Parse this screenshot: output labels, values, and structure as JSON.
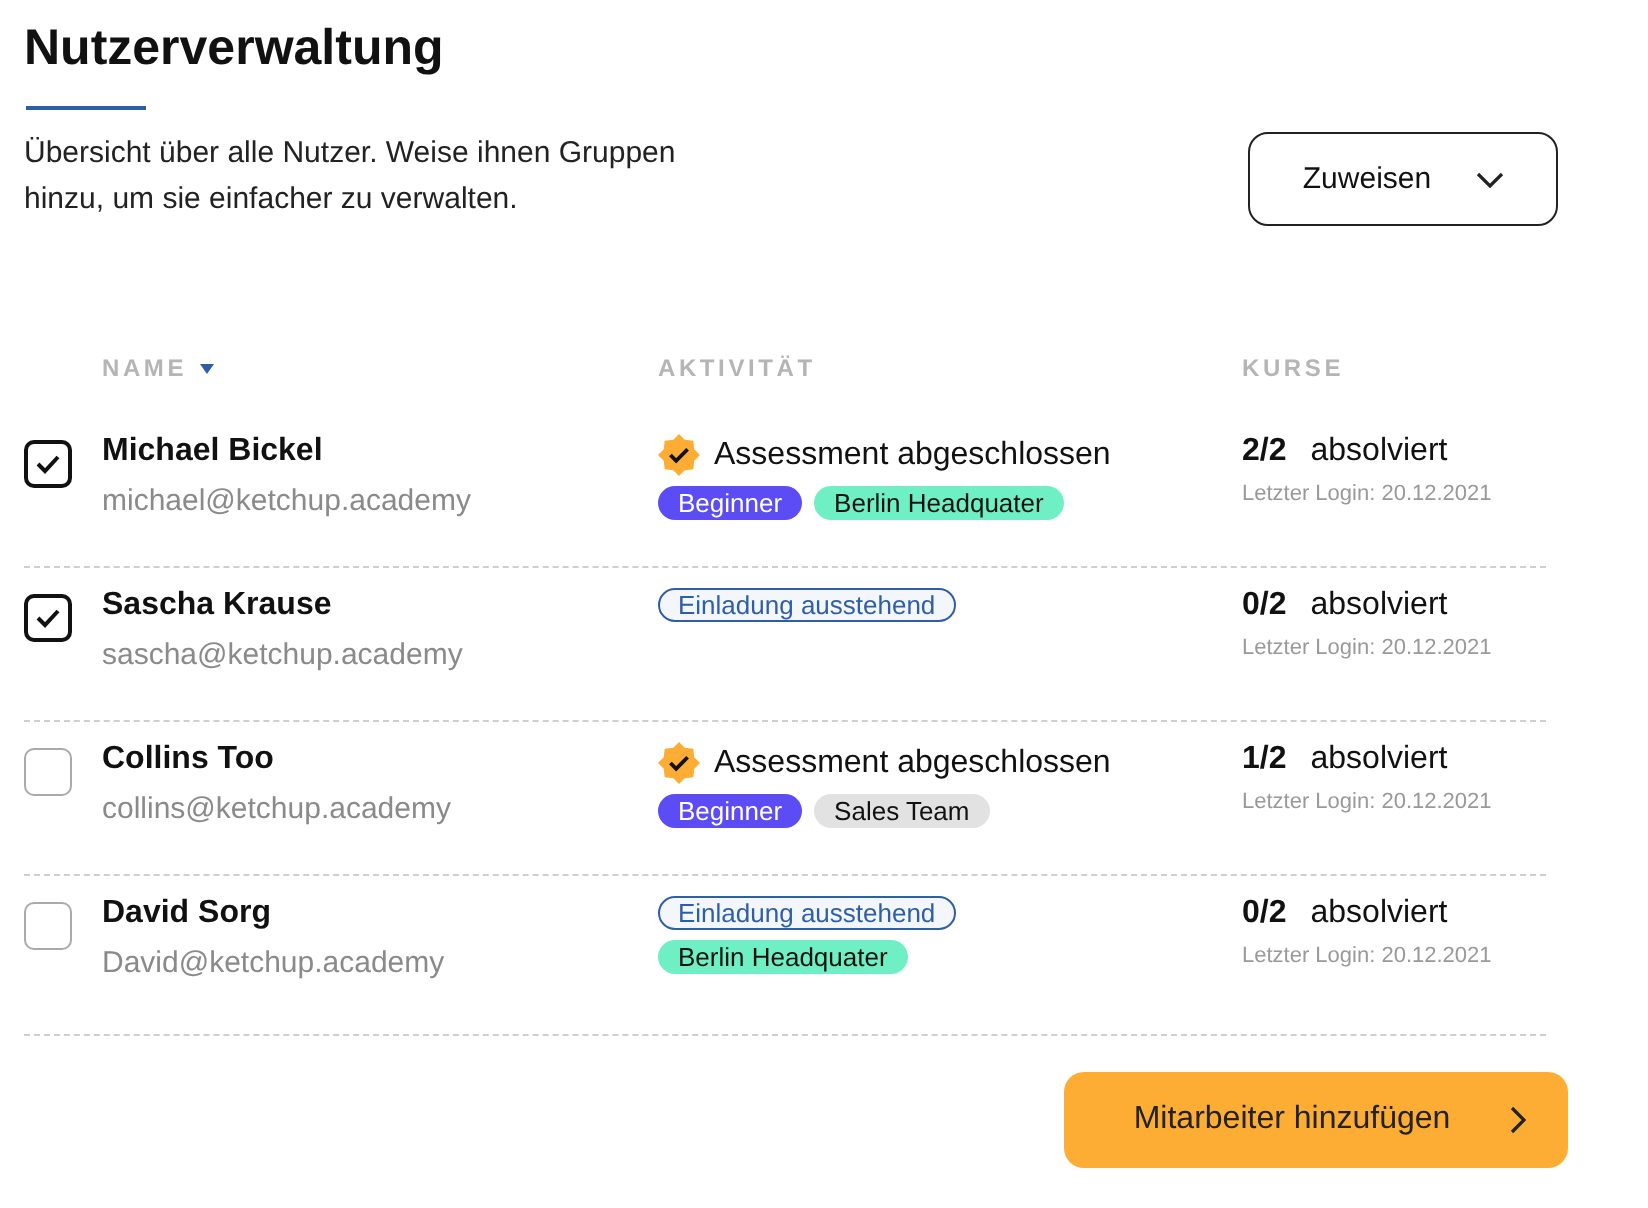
{
  "title": "Nutzerverwaltung",
  "description": "Übersicht über alle Nutzer. Weise ihnen Gruppen hinzu, um sie einfacher zu verwalten.",
  "assign_dropdown": {
    "label": "Zuweisen"
  },
  "table": {
    "columns": [
      {
        "label": "NAME",
        "sorted": true
      },
      {
        "label": "AKTIVITÄT",
        "sorted": false
      },
      {
        "label": "KURSE",
        "sorted": false
      }
    ],
    "rows": [
      {
        "checked": true,
        "name": "Michael Bickel",
        "email": "michael@ketchup.academy",
        "activity": {
          "kind": "assessment",
          "text": "Assessment abgeschlossen"
        },
        "tags": [
          {
            "label": "Beginner",
            "color": "#5b4cf5"
          },
          {
            "label": "Berlin Headquater",
            "color": "#6ef0c4"
          }
        ],
        "score": "2/2",
        "status": "absolviert",
        "last_login": "Letzter Login: 20.12.2021"
      },
      {
        "checked": true,
        "name": "Sascha Krause",
        "email": "sascha@ketchup.academy",
        "activity": {
          "kind": "invitation",
          "text": "Einladung ausstehend"
        },
        "tags": [],
        "score": "0/2",
        "status": "absolviert",
        "last_login": "Letzter Login: 20.12.2021"
      },
      {
        "checked": false,
        "name": "Collins Too",
        "email": "collins@ketchup.academy",
        "activity": {
          "kind": "assessment",
          "text": "Assessment abgeschlossen"
        },
        "tags": [
          {
            "label": "Beginner",
            "color": "#5b4cf5"
          },
          {
            "label": "Sales Team",
            "color": "#e2e2e2"
          }
        ],
        "score": "1/2",
        "status": "absolviert",
        "last_login": "Letzter Login: 20.12.2021"
      },
      {
        "checked": false,
        "name": "David Sorg",
        "email": "David@ketchup.academy",
        "activity": {
          "kind": "invitation",
          "text": "Einladung ausstehend"
        },
        "tags": [
          {
            "label": "Berlin Headquater",
            "color": "#6ef0c4"
          }
        ],
        "score": "0/2",
        "status": "absolviert",
        "last_login": "Letzter Login: 20.12.2021"
      }
    ]
  },
  "add_button": {
    "label": "Mitarbeiter hinzufügen"
  }
}
